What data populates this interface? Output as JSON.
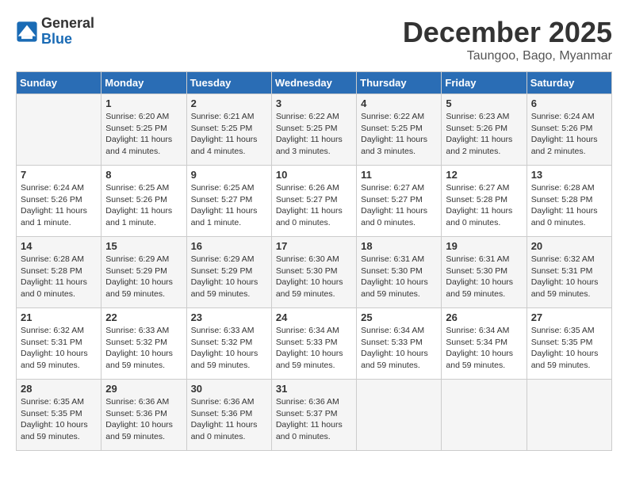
{
  "logo": {
    "general": "General",
    "blue": "Blue"
  },
  "title": {
    "month_year": "December 2025",
    "location": "Taungoo, Bago, Myanmar"
  },
  "headers": [
    "Sunday",
    "Monday",
    "Tuesday",
    "Wednesday",
    "Thursday",
    "Friday",
    "Saturday"
  ],
  "weeks": [
    [
      {
        "day": "",
        "info": ""
      },
      {
        "day": "1",
        "info": "Sunrise: 6:20 AM\nSunset: 5:25 PM\nDaylight: 11 hours\nand 4 minutes."
      },
      {
        "day": "2",
        "info": "Sunrise: 6:21 AM\nSunset: 5:25 PM\nDaylight: 11 hours\nand 4 minutes."
      },
      {
        "day": "3",
        "info": "Sunrise: 6:22 AM\nSunset: 5:25 PM\nDaylight: 11 hours\nand 3 minutes."
      },
      {
        "day": "4",
        "info": "Sunrise: 6:22 AM\nSunset: 5:25 PM\nDaylight: 11 hours\nand 3 minutes."
      },
      {
        "day": "5",
        "info": "Sunrise: 6:23 AM\nSunset: 5:26 PM\nDaylight: 11 hours\nand 2 minutes."
      },
      {
        "day": "6",
        "info": "Sunrise: 6:24 AM\nSunset: 5:26 PM\nDaylight: 11 hours\nand 2 minutes."
      }
    ],
    [
      {
        "day": "7",
        "info": "Sunrise: 6:24 AM\nSunset: 5:26 PM\nDaylight: 11 hours\nand 1 minute."
      },
      {
        "day": "8",
        "info": "Sunrise: 6:25 AM\nSunset: 5:26 PM\nDaylight: 11 hours\nand 1 minute."
      },
      {
        "day": "9",
        "info": "Sunrise: 6:25 AM\nSunset: 5:27 PM\nDaylight: 11 hours\nand 1 minute."
      },
      {
        "day": "10",
        "info": "Sunrise: 6:26 AM\nSunset: 5:27 PM\nDaylight: 11 hours\nand 0 minutes."
      },
      {
        "day": "11",
        "info": "Sunrise: 6:27 AM\nSunset: 5:27 PM\nDaylight: 11 hours\nand 0 minutes."
      },
      {
        "day": "12",
        "info": "Sunrise: 6:27 AM\nSunset: 5:28 PM\nDaylight: 11 hours\nand 0 minutes."
      },
      {
        "day": "13",
        "info": "Sunrise: 6:28 AM\nSunset: 5:28 PM\nDaylight: 11 hours\nand 0 minutes."
      }
    ],
    [
      {
        "day": "14",
        "info": "Sunrise: 6:28 AM\nSunset: 5:28 PM\nDaylight: 11 hours\nand 0 minutes."
      },
      {
        "day": "15",
        "info": "Sunrise: 6:29 AM\nSunset: 5:29 PM\nDaylight: 10 hours\nand 59 minutes."
      },
      {
        "day": "16",
        "info": "Sunrise: 6:29 AM\nSunset: 5:29 PM\nDaylight: 10 hours\nand 59 minutes."
      },
      {
        "day": "17",
        "info": "Sunrise: 6:30 AM\nSunset: 5:30 PM\nDaylight: 10 hours\nand 59 minutes."
      },
      {
        "day": "18",
        "info": "Sunrise: 6:31 AM\nSunset: 5:30 PM\nDaylight: 10 hours\nand 59 minutes."
      },
      {
        "day": "19",
        "info": "Sunrise: 6:31 AM\nSunset: 5:30 PM\nDaylight: 10 hours\nand 59 minutes."
      },
      {
        "day": "20",
        "info": "Sunrise: 6:32 AM\nSunset: 5:31 PM\nDaylight: 10 hours\nand 59 minutes."
      }
    ],
    [
      {
        "day": "21",
        "info": "Sunrise: 6:32 AM\nSunset: 5:31 PM\nDaylight: 10 hours\nand 59 minutes."
      },
      {
        "day": "22",
        "info": "Sunrise: 6:33 AM\nSunset: 5:32 PM\nDaylight: 10 hours\nand 59 minutes."
      },
      {
        "day": "23",
        "info": "Sunrise: 6:33 AM\nSunset: 5:32 PM\nDaylight: 10 hours\nand 59 minutes."
      },
      {
        "day": "24",
        "info": "Sunrise: 6:34 AM\nSunset: 5:33 PM\nDaylight: 10 hours\nand 59 minutes."
      },
      {
        "day": "25",
        "info": "Sunrise: 6:34 AM\nSunset: 5:33 PM\nDaylight: 10 hours\nand 59 minutes."
      },
      {
        "day": "26",
        "info": "Sunrise: 6:34 AM\nSunset: 5:34 PM\nDaylight: 10 hours\nand 59 minutes."
      },
      {
        "day": "27",
        "info": "Sunrise: 6:35 AM\nSunset: 5:35 PM\nDaylight: 10 hours\nand 59 minutes."
      }
    ],
    [
      {
        "day": "28",
        "info": "Sunrise: 6:35 AM\nSunset: 5:35 PM\nDaylight: 10 hours\nand 59 minutes."
      },
      {
        "day": "29",
        "info": "Sunrise: 6:36 AM\nSunset: 5:36 PM\nDaylight: 10 hours\nand 59 minutes."
      },
      {
        "day": "30",
        "info": "Sunrise: 6:36 AM\nSunset: 5:36 PM\nDaylight: 11 hours\nand 0 minutes."
      },
      {
        "day": "31",
        "info": "Sunrise: 6:36 AM\nSunset: 5:37 PM\nDaylight: 11 hours\nand 0 minutes."
      },
      {
        "day": "",
        "info": ""
      },
      {
        "day": "",
        "info": ""
      },
      {
        "day": "",
        "info": ""
      }
    ]
  ]
}
